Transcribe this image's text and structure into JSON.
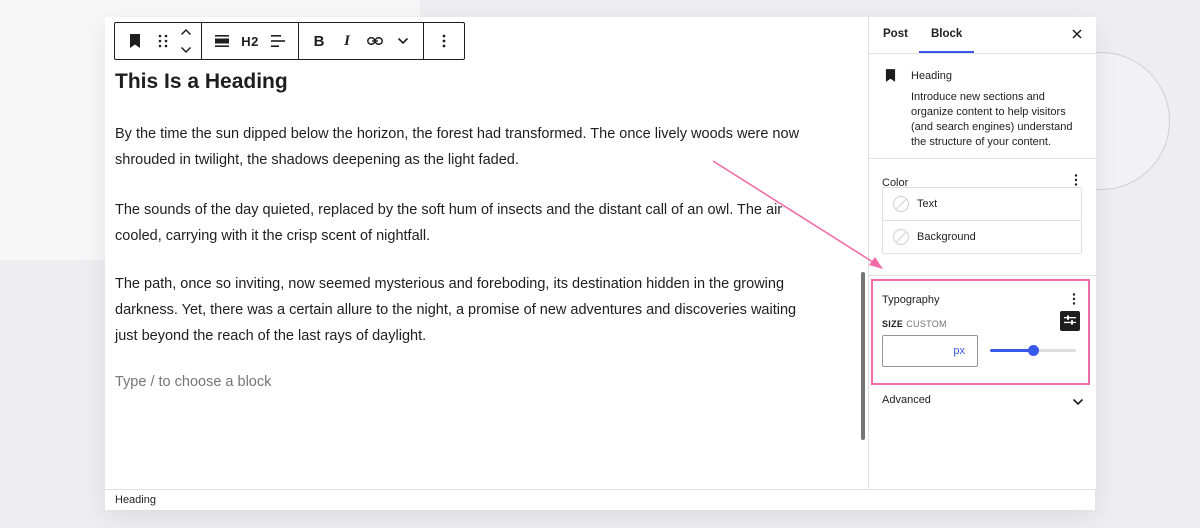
{
  "toolbar": {
    "heading_level_label": "H2",
    "bold_label": "B",
    "italic_label": "I"
  },
  "editor": {
    "heading": "This Is a Heading",
    "paragraphs": [
      "By the time the sun dipped below the horizon, the forest had transformed. The once lively woods were now shrouded in twilight, the shadows deepening as the light faded.",
      "The sounds of the day quieted, replaced by the soft hum of insects and the distant call of an owl. The air cooled, carrying with it the crisp scent of nightfall.",
      "The path, once so inviting, now seemed mysterious and foreboding, its destination hidden in the growing darkness. Yet, there was a certain allure to the night, a promise of new adventures and discoveries waiting just beyond the reach of the last rays of daylight."
    ],
    "placeholder": "Type / to choose a block"
  },
  "statusbar": {
    "breadcrumb": "Heading"
  },
  "sidebar": {
    "tabs": [
      "Post",
      "Block"
    ],
    "active_tab": "Block",
    "block_card": {
      "title": "Heading",
      "description": "Introduce new sections and organize content to help visitors (and search engines) understand the structure of your content."
    },
    "color": {
      "title": "Color",
      "items": [
        "Text",
        "Background"
      ]
    },
    "typography": {
      "title": "Typography",
      "size_label": "SIZE",
      "size_mode": "CUSTOM",
      "size_value": "",
      "size_unit": "px",
      "slider_fraction": 0.5
    },
    "advanced": {
      "title": "Advanced"
    }
  },
  "colors": {
    "accent": "#3858e9",
    "highlight": "#f06ba8",
    "text": "#1e1e1e",
    "muted": "#757575"
  },
  "icons": [
    "bookmark-icon",
    "drag-handle-icon",
    "move-up-icon",
    "move-down-icon",
    "align-icon",
    "text-align-icon",
    "link-icon",
    "chevron-down-icon",
    "more-options-icon",
    "close-icon",
    "custom-size-icon"
  ]
}
